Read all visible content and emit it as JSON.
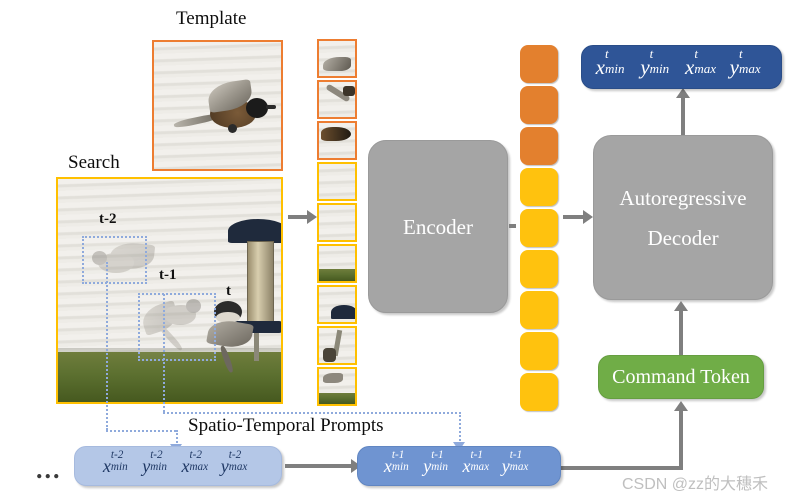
{
  "figure": {
    "labels": {
      "template": "Template",
      "search": "Search",
      "spatio_temporal_prompts": "Spatio-Temporal Prompts",
      "frame_t_minus_2": "t-2",
      "frame_t_minus_1": "t-1",
      "frame_t": "t"
    },
    "blocks": {
      "encoder": "Encoder",
      "decoder_line1": "Autoregressive",
      "decoder_line2": "Decoder",
      "command_token": "Command Token"
    },
    "coord_tokens": {
      "x_min": "x",
      "y_min": "y",
      "x_max": "x",
      "y_max": "y",
      "sub_min": "min",
      "sub_max": "max",
      "sup_t": "t",
      "sup_t_minus_1": "t-1",
      "sup_t_minus_2": "t-2"
    },
    "prompt_prev2_superscript": "t-2",
    "prompt_prev1_superscript": "t-1",
    "output_superscript": "t",
    "ellipsis": "...",
    "watermark": "CSDN @zz的大穗禾",
    "colors": {
      "template_border": "#ED7D31",
      "search_border": "#FFC000",
      "token_orange": "#E3802E",
      "token_yellow": "#FFC20E",
      "block_gray": "#A5A5A5",
      "command_green": "#70AD47",
      "output_blue": "#2F5597",
      "prompt_blue_mid": "#6F94D1",
      "prompt_blue_light": "#B4C7E7",
      "dotted_blue": "#8FAADC",
      "arrow_gray": "#7F7F7F",
      "watermark_gray": "#BFBFBF"
    },
    "token_strip": {
      "orange_count": 3,
      "yellow_count": 6,
      "total": 9
    }
  }
}
